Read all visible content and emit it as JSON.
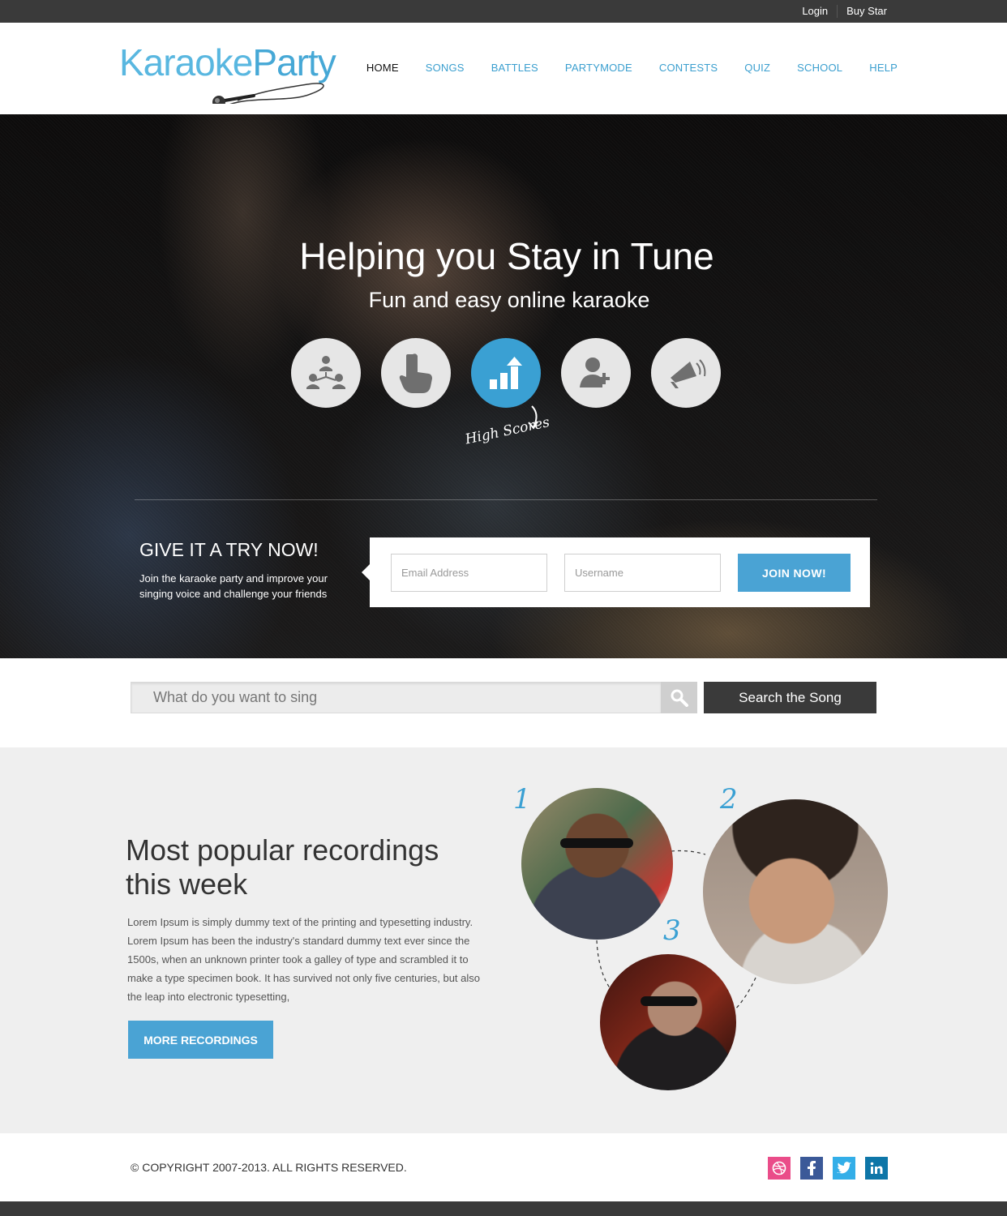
{
  "topbar": {
    "login": "Login",
    "buy": "Buy Star"
  },
  "logo": {
    "part1": "Karaoke",
    "part2": "Party"
  },
  "nav": [
    {
      "label": "HOME",
      "active": true
    },
    {
      "label": "SONGS"
    },
    {
      "label": "BATTLES"
    },
    {
      "label": "PARTYMODE"
    },
    {
      "label": "CONTESTS"
    },
    {
      "label": "QUIZ"
    },
    {
      "label": "SCHOOL"
    },
    {
      "label": "HELP"
    }
  ],
  "hero": {
    "title": "Helping you Stay in Tune",
    "subtitle": "Fun and easy online karaoke",
    "icons": [
      "people-network-icon",
      "hand-pointer-icon",
      "bar-chart-icon",
      "add-user-icon",
      "megaphone-icon"
    ],
    "active_icon_label": "High Scores",
    "try_title": "GIVE IT A TRY NOW!",
    "try_text": "Join the karaoke party and improve your singing voice and challenge your friends",
    "email_placeholder": "Email Address",
    "username_placeholder": "Username",
    "join_label": "JOIN NOW!"
  },
  "search": {
    "placeholder": "What do you want to sing",
    "button_label": "Search the Song"
  },
  "popular": {
    "title": "Most popular recordings this week",
    "text": "Lorem Ipsum is simply dummy text of the printing and typesetting industry. Lorem Ipsum has been the industry's standard dummy text ever since the 1500s, when an unknown printer took a galley of type and scrambled it to make a type specimen book. It has survived not only five centuries, but also the leap into electronic typesetting,",
    "button_label": "MORE RECORDINGS",
    "ranks": [
      "1",
      "2",
      "3"
    ]
  },
  "footer": {
    "copyright": "© COPYRIGHT 2007-2013. ALL RIGHTS RESERVED.",
    "socials": [
      "dribbble-icon",
      "facebook-icon",
      "twitter-icon",
      "linkedin-icon"
    ]
  },
  "colors": {
    "accent": "#4aa3d4",
    "dark": "#3a3a3a",
    "nav": "#3b9fcf"
  }
}
